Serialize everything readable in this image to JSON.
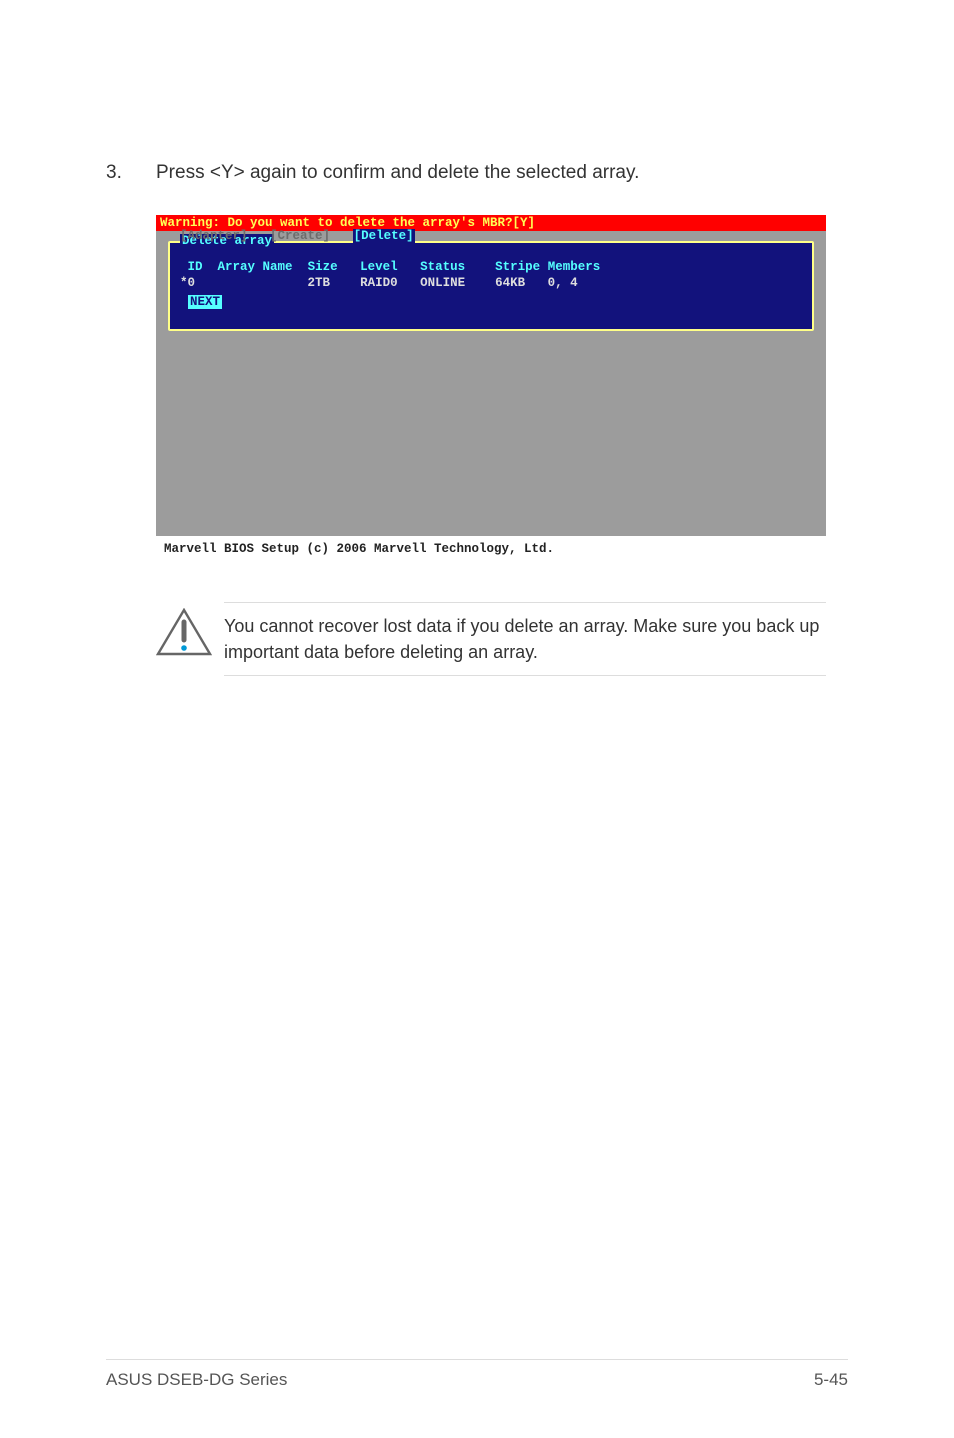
{
  "step": {
    "number": "3.",
    "text": "Press <Y> again to confirm and delete the selected array."
  },
  "bios": {
    "warning": "Warning: Do you want to delete the array's MBR?[Y]",
    "tabs": {
      "adapter": "[Adapter]",
      "create": "[Create]",
      "delete": "[Delete]"
    },
    "panel_title": "Delete array",
    "headers": {
      "id": "ID",
      "array_name": "Array Name",
      "size": "Size",
      "level": "Level",
      "status": "Status",
      "stripe": "Stripe",
      "members": "Members"
    },
    "row": {
      "id": "*0",
      "array_name": "",
      "size": "2TB",
      "level": "RAID0",
      "status": "ONLINE",
      "stripe": "64KB",
      "members": "0, 4"
    },
    "next_label": "NEXT",
    "footer": "Marvell BIOS Setup (c) 2006 Marvell Technology, Ltd."
  },
  "note": {
    "text": "You cannot recover lost data if you delete an array. Make sure you back up important data before deleting an array."
  },
  "page_footer": {
    "left": "ASUS DSEB-DG Series",
    "right": "5-45"
  }
}
